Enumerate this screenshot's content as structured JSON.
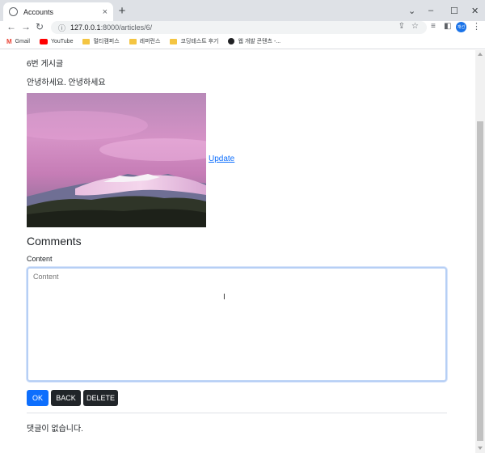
{
  "browser": {
    "tab_title": "Accounts",
    "tab_close": "×",
    "new_tab": "+",
    "window_controls": [
      "⌄",
      "–",
      "☐",
      "✕"
    ],
    "url_host": "127.0.0.1",
    "url_path": ":8000/articles/6/",
    "profile_label": "재선",
    "bookmarks": [
      {
        "icon": "gmail-icon",
        "label": "Gmail"
      },
      {
        "icon": "youtube-icon",
        "label": "YouTube"
      },
      {
        "icon": "folder-icon",
        "label": "멀티캠퍼스"
      },
      {
        "icon": "folder-icon",
        "label": "레퍼런스"
      },
      {
        "icon": "folder-icon",
        "label": "코딩테스트 후기"
      },
      {
        "icon": "site-icon",
        "label": "웹 개발 콘텐츠 -..."
      }
    ]
  },
  "article": {
    "title": "6번 게시글",
    "body": "안녕하세요. 안녕하세요",
    "image_alt": "pink sky over snowy mountains",
    "update_label": "Update"
  },
  "comments": {
    "heading": "Comments",
    "content_label": "Content",
    "textarea_placeholder": "Content",
    "ok_label": "OK",
    "back_label": "BACK",
    "delete_label": "DELETE",
    "empty_message": "댓글이 없습니다."
  },
  "colors": {
    "primary": "#0d6efd",
    "dark": "#212529",
    "link": "#0d6efd"
  }
}
